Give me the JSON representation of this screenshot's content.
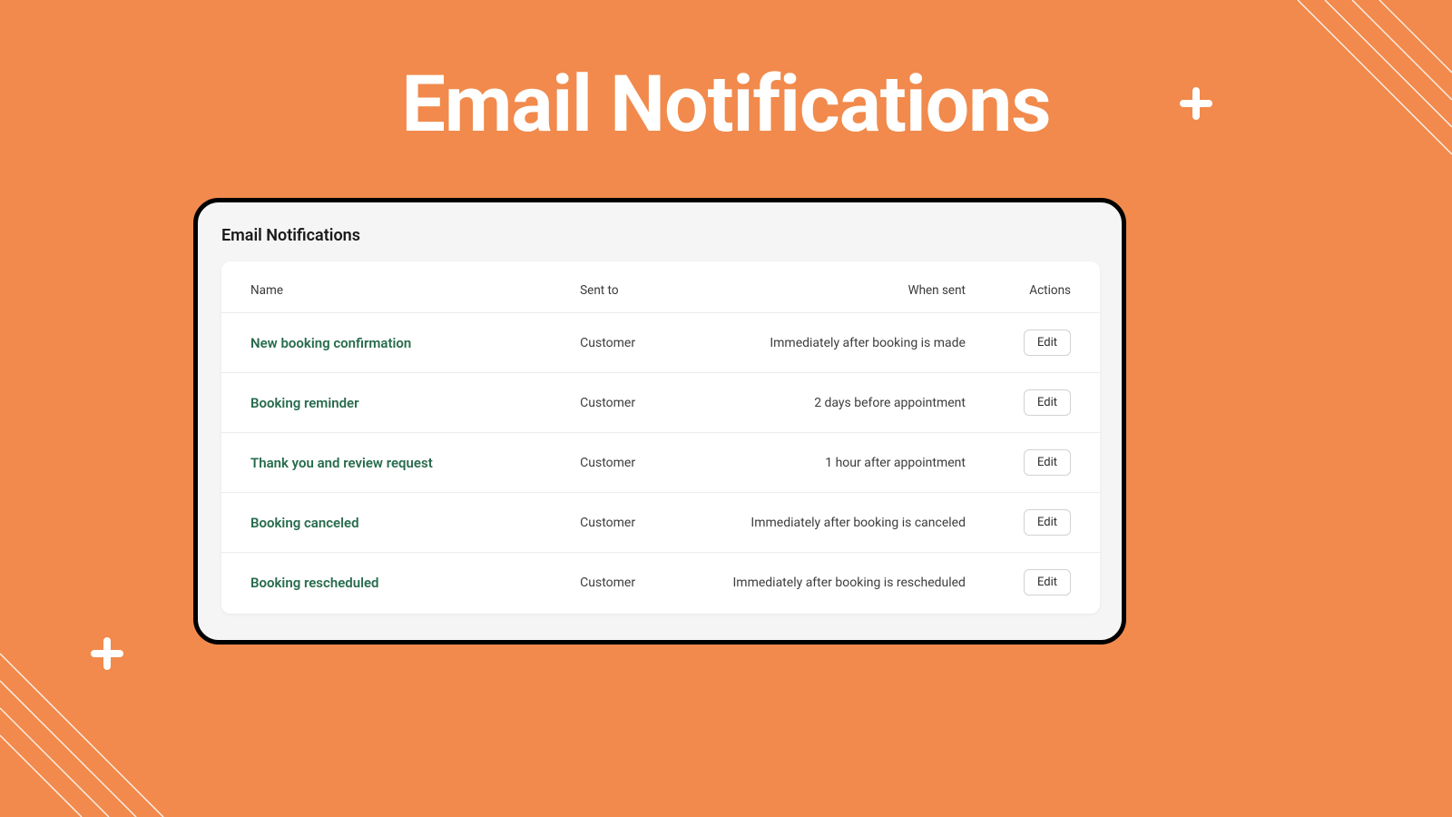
{
  "hero": {
    "title": "Email Notifications"
  },
  "panel": {
    "heading": "Email Notifications",
    "columns": {
      "name": "Name",
      "sent_to": "Sent to",
      "when_sent": "When sent",
      "actions": "Actions"
    },
    "edit_label": "Edit",
    "rows": [
      {
        "name": "New booking confirmation",
        "sent_to": "Customer",
        "when_sent": "Immediately after booking is made"
      },
      {
        "name": "Booking reminder",
        "sent_to": "Customer",
        "when_sent": "2 days before appointment"
      },
      {
        "name": "Thank you and review request",
        "sent_to": "Customer",
        "when_sent": "1 hour after appointment"
      },
      {
        "name": "Booking canceled",
        "sent_to": "Customer",
        "when_sent": "Immediately after booking is canceled"
      },
      {
        "name": "Booking rescheduled",
        "sent_to": "Customer",
        "when_sent": "Immediately after booking is rescheduled"
      }
    ]
  },
  "decor": {
    "plus_tr": "plus-icon",
    "plus_bl": "plus-icon"
  }
}
